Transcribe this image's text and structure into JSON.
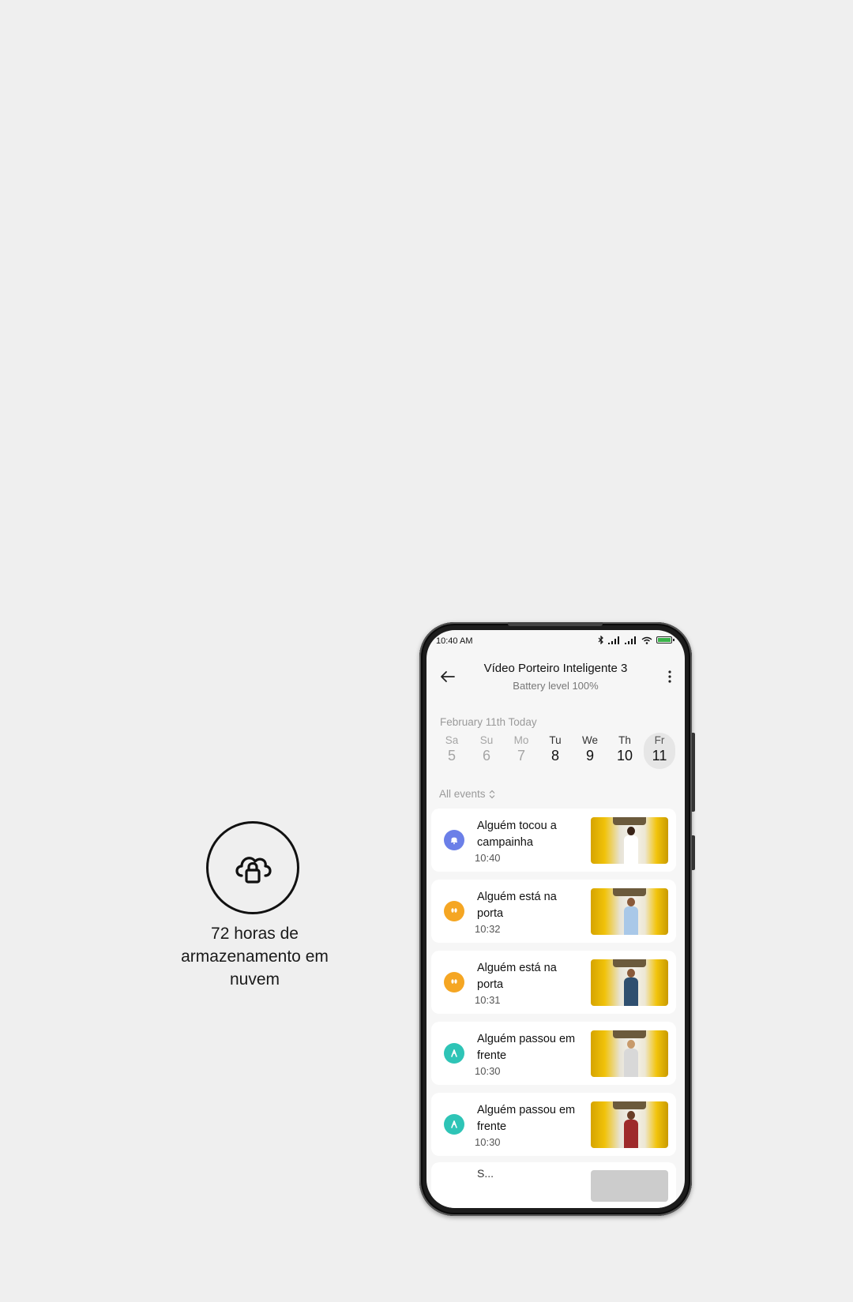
{
  "feature": {
    "icon": "cloud-lock-icon",
    "text_line1": "72 horas de",
    "text_line2": "armazenamento em",
    "text_line3": "nuvem"
  },
  "status_bar": {
    "time": "10:40 AM",
    "icons": [
      "bluetooth-icon",
      "signal-icon",
      "signal-icon",
      "wifi-icon",
      "battery-icon"
    ]
  },
  "header": {
    "title": "Vídeo Porteiro Inteligente 3",
    "subtitle": "Battery level 100%"
  },
  "date_label": "February 11th Today",
  "days": [
    {
      "name": "Sa",
      "num": "5",
      "state": "inactive"
    },
    {
      "name": "Su",
      "num": "6",
      "state": "inactive"
    },
    {
      "name": "Mo",
      "num": "7",
      "state": "inactive"
    },
    {
      "name": "Tu",
      "num": "8",
      "state": "active"
    },
    {
      "name": "We",
      "num": "9",
      "state": "active"
    },
    {
      "name": "Th",
      "num": "10",
      "state": "active"
    },
    {
      "name": "Fr",
      "num": "11",
      "state": "today"
    }
  ],
  "filter_label": "All events",
  "events": [
    {
      "title": "Alguém tocou a campainha",
      "time": "10:40",
      "icon": "bell-icon",
      "color": "#6b7fe8",
      "shirt": "#ffffff"
    },
    {
      "title": "Alguém está na porta",
      "time": "10:32",
      "icon": "footprints-icon",
      "color": "#f5a623",
      "shirt": "#a9c8e8"
    },
    {
      "title": "Alguém está na porta",
      "time": "10:31",
      "icon": "footprints-icon",
      "color": "#f5a623",
      "shirt": "#2f4f6f"
    },
    {
      "title": "Alguém passou em frente",
      "time": "10:30",
      "icon": "walking-icon",
      "color": "#2ec4b6",
      "shirt": "#d8d8d8"
    },
    {
      "title": "Alguém passou em frente",
      "time": "10:30",
      "icon": "walking-icon",
      "color": "#2ec4b6",
      "shirt": "#9e2a2b"
    }
  ],
  "peek_event": {
    "title": "S..."
  }
}
